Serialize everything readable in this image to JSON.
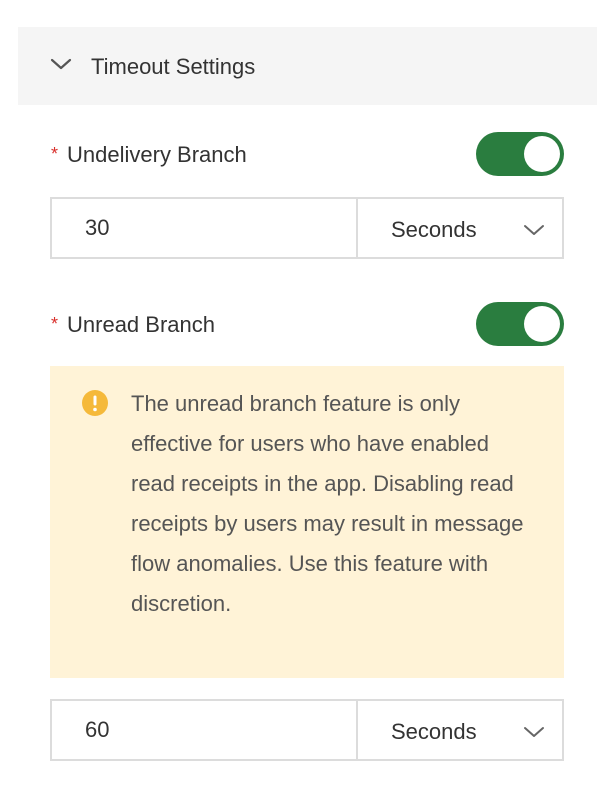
{
  "section": {
    "title": "Timeout Settings"
  },
  "undelivery": {
    "required_mark": "*",
    "label": "Undelivery Branch",
    "enabled": true,
    "value": "30",
    "unit": "Seconds"
  },
  "unread": {
    "required_mark": "*",
    "label": "Unread Branch",
    "enabled": true,
    "warning": "The unread branch feature is only effective for users who have enabled read receipts in the app. Disabling read receipts by users may result in message flow anomalies. Use this feature with discretion.",
    "value": "60",
    "unit": "Seconds"
  },
  "colors": {
    "toggle_on": "#2a7d3f",
    "required": "#d9302c",
    "warning_bg": "#fff3d7",
    "warning_icon": "#f5b93a"
  }
}
